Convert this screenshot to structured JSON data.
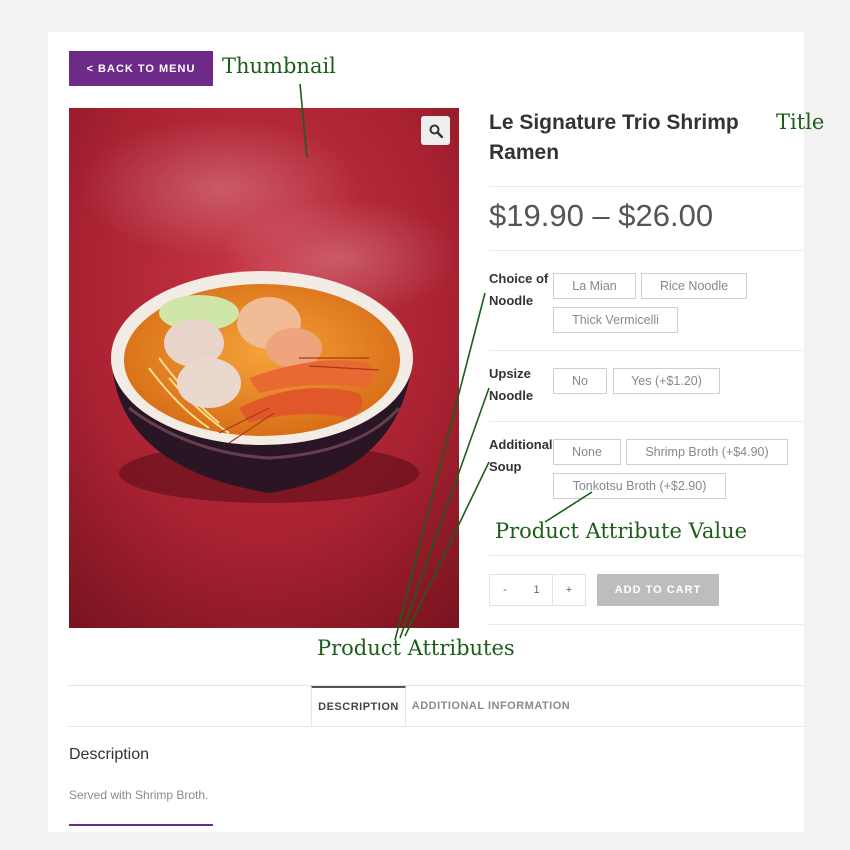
{
  "back_button": {
    "label": "< BACK TO MENU"
  },
  "product": {
    "title": "Le Signature Trio Shrimp Ramen",
    "price": "$19.90 – $26.00",
    "zoom_icon": "magnifier-icon"
  },
  "attributes": [
    {
      "label": "Choice of Noodle",
      "values": [
        "La Mian",
        "Rice Noodle",
        "Thick Vermicelli"
      ]
    },
    {
      "label": "Upsize Noodle",
      "values": [
        "No",
        "Yes (+$1.20)"
      ]
    },
    {
      "label": "Additional Soup",
      "values": [
        "None",
        "Shrimp Broth (+$4.90)",
        "Tonkotsu Broth (+$2.90)"
      ]
    }
  ],
  "cart": {
    "minus": "-",
    "quantity": "1",
    "plus": "+",
    "add_label": "ADD TO CART"
  },
  "tabs": [
    {
      "label": "DESCRIPTION",
      "active": true
    },
    {
      "label": "ADDITIONAL INFORMATION",
      "active": false
    }
  ],
  "description": {
    "heading": "Description",
    "text": "Served with Shrimp Broth."
  },
  "annotations": {
    "thumbnail": "Thumbnail",
    "title": "Title",
    "attribute_value": "Product Attribute Value",
    "attributes": "Product Attributes"
  },
  "colors": {
    "brand_purple": "#6d2a87",
    "annotation_green": "#1a5e1a",
    "background_red": "#b3283a"
  }
}
